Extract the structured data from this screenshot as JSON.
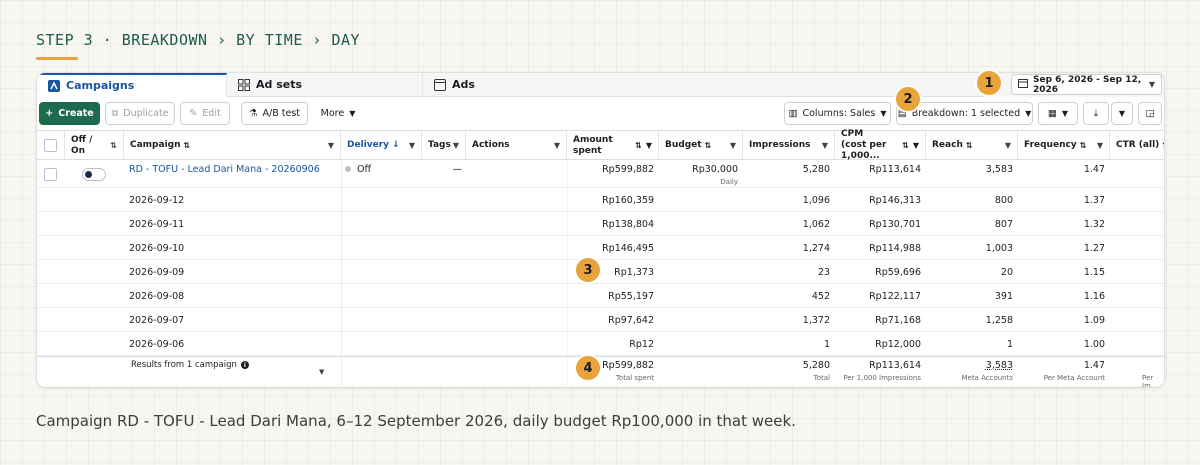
{
  "step_title": "STEP 3 · BREAKDOWN › BY TIME › DAY",
  "caption": "Campaign RD - TOFU - Lead Dari Mana, 6–12 September 2026, daily budget Rp100,000 in that week.",
  "colors": {
    "accent": "#1d6b4f",
    "link": "#1a56a6",
    "badge": "#e8a33a"
  },
  "tabs": [
    {
      "label": "Campaigns",
      "icon": "campaign-icon",
      "active": true
    },
    {
      "label": "Ad sets",
      "icon": "grid-icon",
      "active": false
    },
    {
      "label": "Ads",
      "icon": "ad-icon",
      "active": false
    }
  ],
  "date_range": "Sep 6, 2026 - Sep 12, 2026",
  "toolbar": {
    "create": "Create",
    "duplicate": "Duplicate",
    "edit": "Edit",
    "ab_test": "A/B test",
    "more": "More",
    "columns": "Columns: Sales",
    "breakdown": "Breakdown: 1 selected"
  },
  "headers": {
    "off_on": "Off / On",
    "campaign": "Campaign",
    "delivery": "Delivery",
    "tags": "Tags",
    "actions": "Actions",
    "amount_spent": "Amount spent",
    "budget": "Budget",
    "impressions": "Impressions",
    "cpm": "CPM (cost per 1,000...",
    "reach": "Reach",
    "frequency": "Frequency",
    "ctr": "CTR (all)"
  },
  "campaign_row": {
    "name": "RD - TOFU - Lead Dari Mana - 20260906",
    "delivery": "Off",
    "tags": "—",
    "amount_spent": "Rp599,882",
    "budget": "Rp30,000",
    "budget_sub": "Daily",
    "impressions": "5,280",
    "cpm": "Rp113,614",
    "reach": "3,583",
    "frequency": "1.47"
  },
  "day_rows": [
    {
      "date": "2026-09-12",
      "spent": "Rp160,359",
      "impressions": "1,096",
      "cpm": "Rp146,313",
      "reach": "800",
      "frequency": "1.37"
    },
    {
      "date": "2026-09-11",
      "spent": "Rp138,804",
      "impressions": "1,062",
      "cpm": "Rp130,701",
      "reach": "807",
      "frequency": "1.32"
    },
    {
      "date": "2026-09-10",
      "spent": "Rp146,495",
      "impressions": "1,274",
      "cpm": "Rp114,988",
      "reach": "1,003",
      "frequency": "1.27"
    },
    {
      "date": "2026-09-09",
      "spent": "Rp1,373",
      "impressions": "23",
      "cpm": "Rp59,696",
      "reach": "20",
      "frequency": "1.15"
    },
    {
      "date": "2026-09-08",
      "spent": "Rp55,197",
      "impressions": "452",
      "cpm": "Rp122,117",
      "reach": "391",
      "frequency": "1.16"
    },
    {
      "date": "2026-09-07",
      "spent": "Rp97,642",
      "impressions": "1,372",
      "cpm": "Rp71,168",
      "reach": "1,258",
      "frequency": "1.09"
    },
    {
      "date": "2026-09-06",
      "spent": "Rp12",
      "impressions": "1",
      "cpm": "Rp12,000",
      "reach": "1",
      "frequency": "1.00"
    }
  ],
  "totals": {
    "label": "Results from 1 campaign",
    "spent": "Rp599,882",
    "spent_sub": "Total spent",
    "impressions": "5,280",
    "impressions_sub": "Total",
    "cpm": "Rp113,614",
    "cpm_sub": "Per 1,000 Impressions",
    "reach": "3,583",
    "reach_sub": "Meta Accounts",
    "frequency": "1.47",
    "frequency_sub": "Per Meta Account",
    "ctr_sub": "Per Im"
  },
  "badges": [
    "1",
    "2",
    "3",
    "4"
  ]
}
